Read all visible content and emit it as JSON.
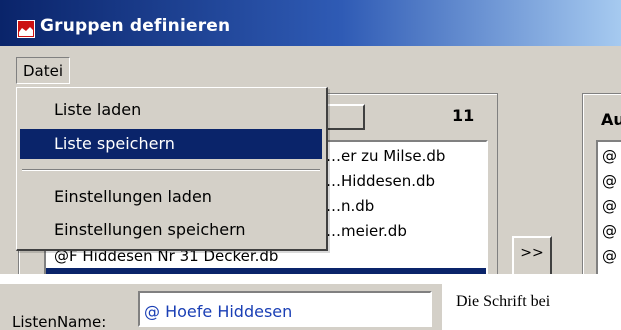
{
  "window": {
    "title": "Gruppen definieren",
    "icon": "app-flag-icon",
    "accent": "#0a246a"
  },
  "menu": {
    "datei": "Datei",
    "items": [
      {
        "label": "Liste laden",
        "highlighted": false
      },
      {
        "label": "Liste speichern",
        "highlighted": true
      },
      {
        "label": "Einstellungen laden",
        "highlighted": false
      },
      {
        "label": "Einstellungen speichern",
        "highlighted": false
      }
    ]
  },
  "left_panel": {
    "count": "11",
    "list": [
      "…er zu Milse.db",
      "…Hiddesen.db",
      "…n.db",
      "…meier.db",
      "@F Hiddesen Nr 31 Decker.db"
    ]
  },
  "move_button": ">>",
  "right_panel": {
    "header": "Au",
    "items": [
      "@",
      "@",
      "@",
      "@",
      "@"
    ]
  },
  "form": {
    "listname_label": "ListenName:",
    "listname_value": "@ Hoefe Hiddesen",
    "note": "Die Schrift bei"
  }
}
